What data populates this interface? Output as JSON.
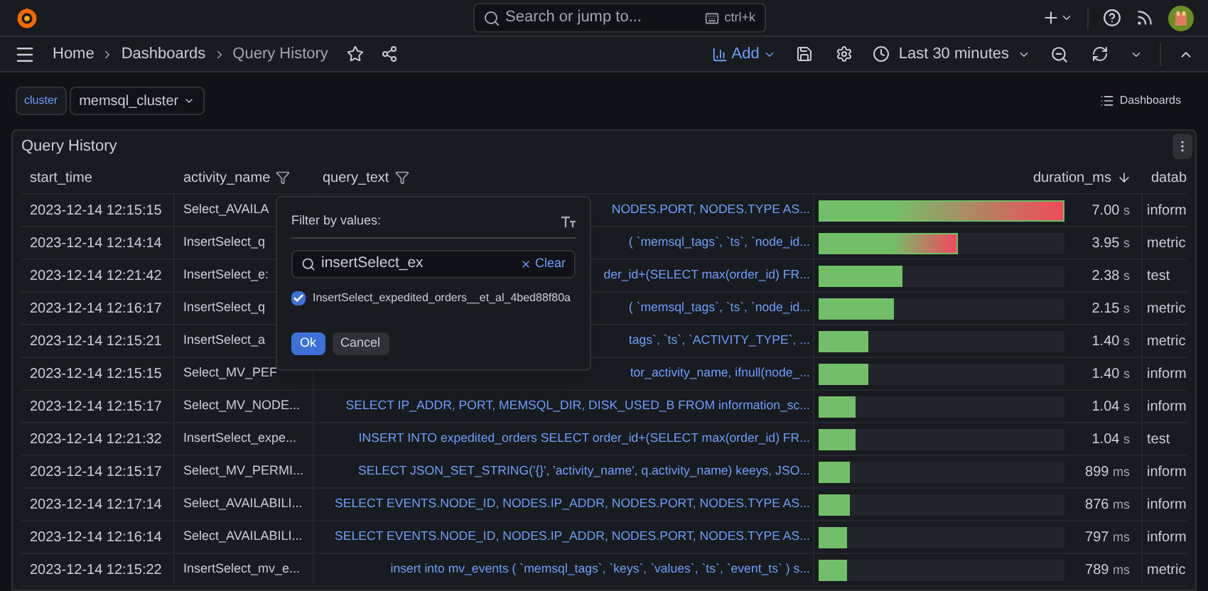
{
  "search": {
    "placeholder": "Search or jump to...",
    "shortcut": "ctrl+k"
  },
  "breadcrumbs": [
    {
      "label": "Home",
      "current": false
    },
    {
      "label": "Dashboards",
      "current": false
    },
    {
      "label": "Query History",
      "current": true
    }
  ],
  "toolbar": {
    "add": "Add",
    "time_range": "Last 30 minutes"
  },
  "variables": [
    {
      "label": "cluster",
      "value": "memsql_cluster"
    }
  ],
  "dashboards_link": "Dashboards",
  "panel": {
    "title": "Query History",
    "columns": [
      {
        "label": "start_time",
        "filter": false,
        "sorted": false
      },
      {
        "label": "activity_name",
        "filter": true,
        "sorted": false
      },
      {
        "label": "query_text",
        "filter": true,
        "sorted": false
      },
      {
        "label": "duration_ms",
        "filter": false,
        "sorted": true
      },
      {
        "label": "datab"
      }
    ],
    "rows": [
      {
        "start_time": "2023-12-14 12:15:15",
        "activity_name": "Select_AVAILA",
        "query_text": "NODES.PORT, NODES.TYPE AS...",
        "level": 1.0,
        "duration": "7.00",
        "unit": "s",
        "database": "inform"
      },
      {
        "start_time": "2023-12-14 12:14:14",
        "activity_name": "InsertSelect_q",
        "query_text": "( `memsql_tags`, `ts`, `node_id...",
        "level": 0.564,
        "duration": "3.95",
        "unit": "s",
        "database": "metric"
      },
      {
        "start_time": "2023-12-14 12:21:42",
        "activity_name": "InsertSelect_e:",
        "query_text": "der_id+(SELECT max(order_id) FR...",
        "level": 0.34,
        "duration": "2.38",
        "unit": "s",
        "database": "test"
      },
      {
        "start_time": "2023-12-14 12:16:17",
        "activity_name": "InsertSelect_q",
        "query_text": "( `memsql_tags`, `ts`, `node_id...",
        "level": 0.307,
        "duration": "2.15",
        "unit": "s",
        "database": "metric"
      },
      {
        "start_time": "2023-12-14 12:15:21",
        "activity_name": "InsertSelect_a",
        "query_text": "tags`, `ts`, `ACTIVITY_TYPE`, ...",
        "level": 0.2,
        "duration": "1.40",
        "unit": "s",
        "database": "metric"
      },
      {
        "start_time": "2023-12-14 12:15:15",
        "activity_name": "Select_MV_PEF",
        "query_text": "tor_activity_name, ifnull(node_...",
        "level": 0.2,
        "duration": "1.40",
        "unit": "s",
        "database": "inform"
      },
      {
        "start_time": "2023-12-14 12:15:17",
        "activity_name": "Select_MV_NODE...",
        "query_text": "SELECT IP_ADDR, PORT, MEMSQL_DIR, DISK_USED_B FROM information_sc...",
        "level": 0.149,
        "duration": "1.04",
        "unit": "s",
        "database": "inform"
      },
      {
        "start_time": "2023-12-14 12:21:32",
        "activity_name": "InsertSelect_expe...",
        "query_text": "INSERT INTO expedited_orders SELECT order_id+(SELECT max(order_id) FR...",
        "level": 0.149,
        "duration": "1.04",
        "unit": "s",
        "database": "test"
      },
      {
        "start_time": "2023-12-14 12:15:17",
        "activity_name": "Select_MV_PERMI...",
        "query_text": "SELECT JSON_SET_STRING('{}', 'activity_name', q.activity_name) keeys, JSO...",
        "level": 0.128,
        "duration": "899",
        "unit": "ms",
        "database": "inform"
      },
      {
        "start_time": "2023-12-14 12:17:14",
        "activity_name": "Select_AVAILABILI...",
        "query_text": "SELECT EVENTS.NODE_ID, NODES.IP_ADDR, NODES.PORT, NODES.TYPE AS...",
        "level": 0.125,
        "duration": "876",
        "unit": "ms",
        "database": "inform"
      },
      {
        "start_time": "2023-12-14 12:16:14",
        "activity_name": "Select_AVAILABILI...",
        "query_text": "SELECT EVENTS.NODE_ID, NODES.IP_ADDR, NODES.PORT, NODES.TYPE AS...",
        "level": 0.114,
        "duration": "797",
        "unit": "ms",
        "database": "inform"
      },
      {
        "start_time": "2023-12-14 12:15:22",
        "activity_name": "InsertSelect_mv_e...",
        "query_text": "insert into mv_events ( `memsql_tags`, `keys`, `values`, `ts`, `event_ts` ) s...",
        "level": 0.113,
        "duration": "789",
        "unit": "ms",
        "database": "metric"
      }
    ]
  },
  "filter_popup": {
    "title": "Filter by values:",
    "search_value": "insertSelect_ex",
    "clear": "Clear",
    "options": [
      {
        "label": "InsertSelect_expedited_orders__et_al_4bed88f80a",
        "checked": true
      }
    ],
    "buttons": [
      {
        "label": "Ok",
        "kind": "primary"
      },
      {
        "label": "Cancel",
        "kind": "secondary"
      }
    ]
  }
}
